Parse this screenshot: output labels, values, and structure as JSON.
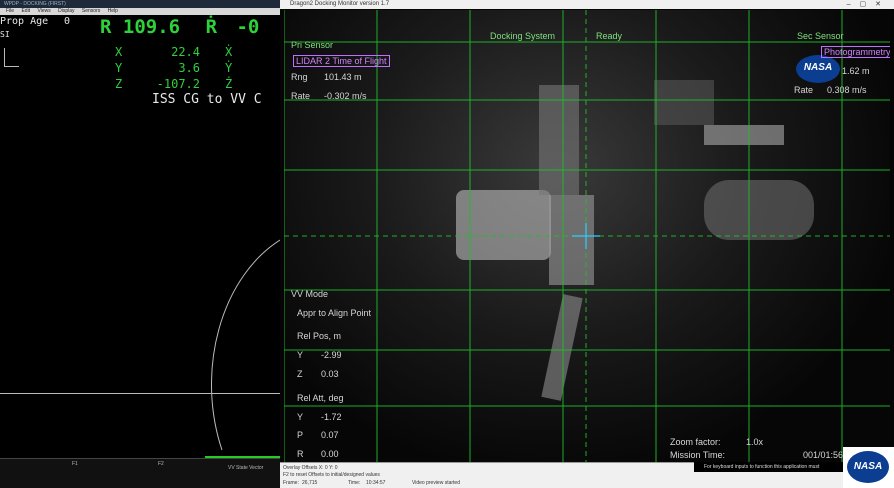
{
  "left_window": {
    "title": "WPDP - DOCKING (FIRST)",
    "menu": [
      "File",
      "Edit",
      "Views",
      "Display",
      "Sensors",
      "Help"
    ],
    "prop_age_label": "Prop Age",
    "prop_age_value": "0",
    "r_label": "R",
    "r_value": "109.6",
    "rdot_label": "Ṙ",
    "rdot_value": "-0",
    "si_label": "SI",
    "x_label": "X",
    "x_value": "22.4",
    "xdot_label": "Ẋ",
    "y_label": "Y",
    "y_value": "3.6",
    "ydot_label": "Ẏ",
    "z_label": "Z",
    "z_value": "-107.2",
    "zdot_label": "Ż",
    "frame_note": "ISS CG to VV C",
    "bottom_f1": "F1",
    "bottom_f2": "F2",
    "vv_state": "VV State Vector"
  },
  "right_window": {
    "title": "Dragon2 Docking Monitor version 1.7",
    "header": {
      "pri_sensor": "Pri Sensor",
      "docking_system": "Docking System",
      "ready": "Ready",
      "sec_sensor": "Sec Sensor",
      "lidar_mode": "LIDAR 2 Time of Flight",
      "sec_mode": "Photogrammetry"
    },
    "pri": {
      "rng_label": "Rng",
      "rng_value": "101.43 m",
      "rate_label": "Rate",
      "rate_value": "-0.302 m/s"
    },
    "sec": {
      "rng_value": "1.62 m",
      "rate_label": "Rate",
      "rate_value": "0.308 m/s"
    },
    "vv_mode_label": "VV Mode",
    "vv_mode_value": "Appr to Align Point",
    "rel_pos_label": "Rel Pos, m",
    "rel_pos": [
      {
        "axis": "Y",
        "value": "-2.99"
      },
      {
        "axis": "Z",
        "value": "0.03"
      }
    ],
    "rel_att_label": "Rel Att, deg",
    "rel_att": [
      {
        "axis": "Y",
        "value": "-1.72"
      },
      {
        "axis": "P",
        "value": "0.07"
      },
      {
        "axis": "R",
        "value": "0.00"
      }
    ],
    "zoom_label": "Zoom factor:",
    "zoom_value": "1.0x",
    "mission_label": "Mission Time:",
    "mission_value": "001/01:56",
    "nasa_logo_text": "NASA",
    "bottom": {
      "overlay_offsets": "Overlay Offsets  X: 0    Y: 0",
      "f2_hint": "F2 to reset Offsets to initial/designed values",
      "frame_label": "Frame:",
      "frame_value": "26,715",
      "time_label": "Time:",
      "time_value": "10:34:57",
      "video_status": "Video preview started",
      "keyboard_hint": "For keyboard inputs to function this application must"
    }
  },
  "corner_logo_text": "NASA",
  "colors": {
    "hud_green": "#2dd13a",
    "grid_green": "#1fbf2a",
    "purple": "#c070ff",
    "nasa_blue": "#0b3d91"
  }
}
